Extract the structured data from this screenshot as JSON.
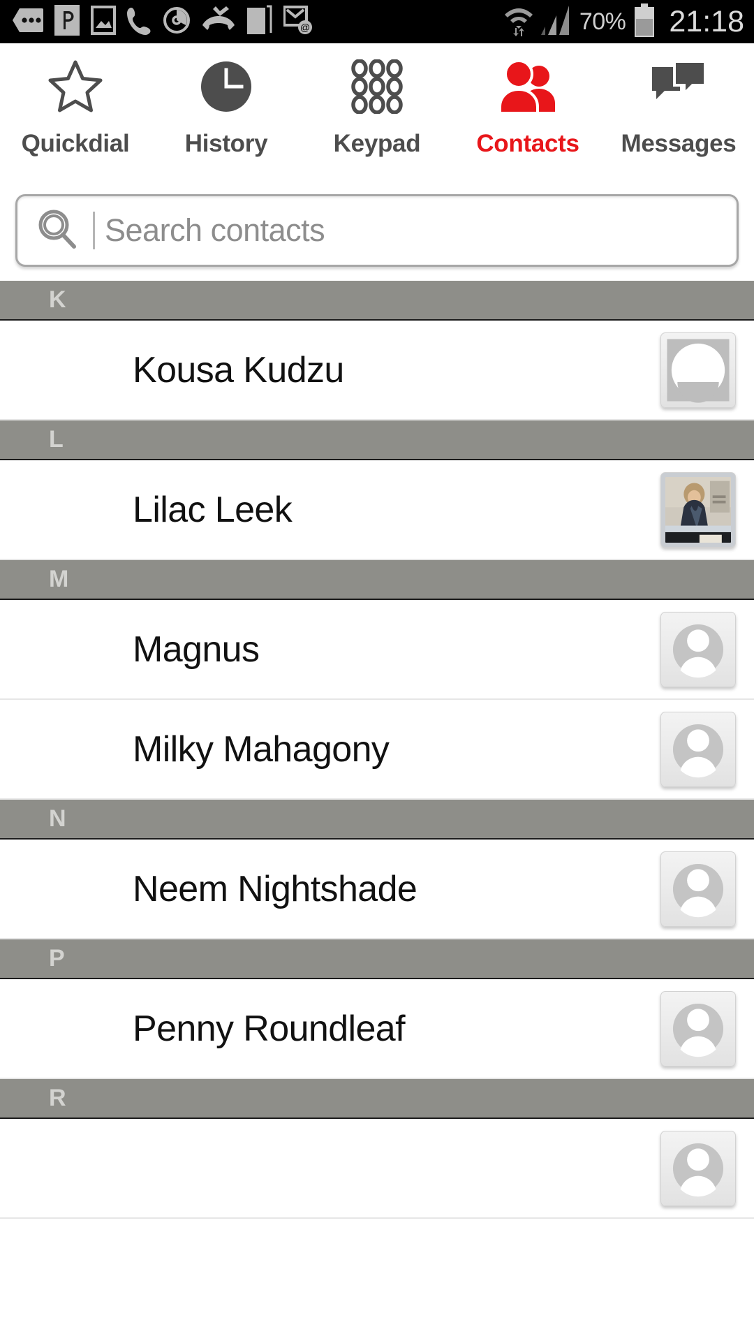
{
  "statusbar": {
    "icons_left": [
      "messaging-dots-icon",
      "pushbullet-icon",
      "screenshot-image-icon",
      "phone-call-icon",
      "alarm-timer-icon",
      "missed-call-icon",
      "sim-card-icon",
      "email-sync-icon"
    ],
    "icons_right": [
      "wifi-transfer-icon",
      "cellular-signal-icon"
    ],
    "battery_percent": "70%",
    "battery_icon": "battery-icon",
    "clock": "21:18"
  },
  "tabs": [
    {
      "label": "Quickdial",
      "icon": "star-icon",
      "active": false
    },
    {
      "label": "History",
      "icon": "clock-icon",
      "active": false
    },
    {
      "label": "Keypad",
      "icon": "keypad-dots-icon",
      "active": false
    },
    {
      "label": "Contacts",
      "icon": "contacts-people-icon",
      "active": true
    },
    {
      "label": "Messages",
      "icon": "messages-bubbles-icon",
      "active": false
    }
  ],
  "accent_color": "#e8161a",
  "search": {
    "icon": "search-icon",
    "placeholder": "Search contacts",
    "value": ""
  },
  "list": [
    {
      "type": "header",
      "letter": "K"
    },
    {
      "type": "contact",
      "name": "Kousa Kudzu",
      "avatar": "inverted-person-avatar"
    },
    {
      "type": "header",
      "letter": "L"
    },
    {
      "type": "contact",
      "name": "Lilac Leek",
      "avatar": "photo-avatar"
    },
    {
      "type": "header",
      "letter": "M"
    },
    {
      "type": "contact",
      "name": "Magnus",
      "avatar": "default-person-avatar"
    },
    {
      "type": "contact",
      "name": "Milky Mahagony",
      "avatar": "default-person-avatar"
    },
    {
      "type": "header",
      "letter": "N"
    },
    {
      "type": "contact",
      "name": "Neem Nightshade",
      "avatar": "default-person-avatar"
    },
    {
      "type": "header",
      "letter": "P"
    },
    {
      "type": "contact",
      "name": "Penny Roundleaf",
      "avatar": "default-person-avatar"
    },
    {
      "type": "header",
      "letter": "R"
    },
    {
      "type": "contact",
      "name": "",
      "avatar": "default-person-avatar"
    }
  ]
}
